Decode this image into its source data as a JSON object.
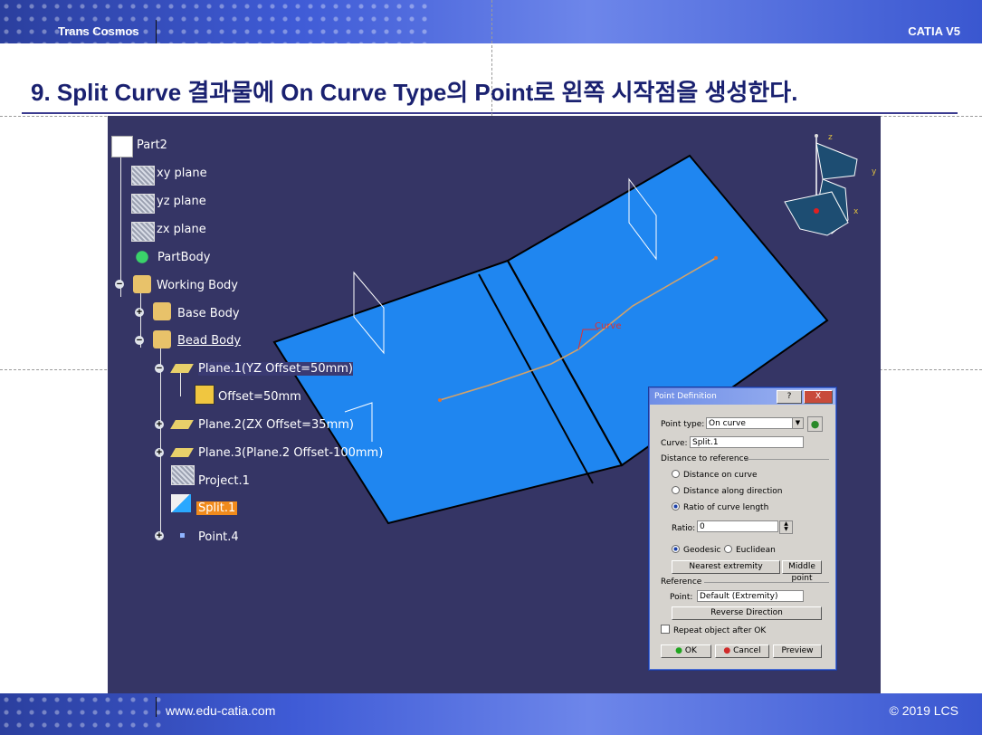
{
  "header": {
    "brand": "Trans Cosmos",
    "product": "CATIA V5"
  },
  "title": "9. Split Curve 결과물에 On Curve Type의 Point로 왼쪽 시작점을 생성한다.",
  "tree": {
    "root": "Part2",
    "items": [
      {
        "label": "xy plane"
      },
      {
        "label": "yz plane"
      },
      {
        "label": "zx plane"
      },
      {
        "label": "PartBody"
      },
      {
        "label": "Working Body"
      },
      {
        "label": "Base Body"
      },
      {
        "label": "Bead Body"
      },
      {
        "label": "Plane.1(YZ Offset=50mm)"
      },
      {
        "label": "Offset=50mm"
      },
      {
        "label": "Plane.2(ZX Offset=35mm)"
      },
      {
        "label": "Plane.3(Plane.2 Offset-100mm)"
      },
      {
        "label": "Project.1"
      },
      {
        "label": "Split.1"
      },
      {
        "label": "Point.4"
      }
    ]
  },
  "viewport": {
    "curve_label": "Curve",
    "axis_z": "z",
    "axis_y": "y",
    "axis_x": "x"
  },
  "dialog": {
    "title": "Point Definition",
    "help_button": "?",
    "close_button": "X",
    "point_type_label": "Point type:",
    "point_type_value": "On curve",
    "curve_label": "Curve:",
    "curve_value": "Split.1",
    "distance_section": "Distance to reference",
    "opt_distance_on_curve": "Distance on curve",
    "opt_distance_along_direction": "Distance along direction",
    "opt_ratio": "Ratio of curve length",
    "ratio_label": "Ratio:",
    "ratio_value": "0",
    "geodesic": "Geodesic",
    "euclidean": "Euclidean",
    "nearest_extremity": "Nearest extremity",
    "middle_point": "Middle point",
    "reference_section": "Reference",
    "point_label": "Point:",
    "point_value": "Default (Extremity)",
    "reverse_direction": "Reverse Direction",
    "repeat_object": "Repeat object after OK",
    "ok": "OK",
    "cancel": "Cancel",
    "preview": "Preview"
  },
  "footer": {
    "url": "www.edu-catia.com",
    "copyright": "© 2019 LCS"
  }
}
